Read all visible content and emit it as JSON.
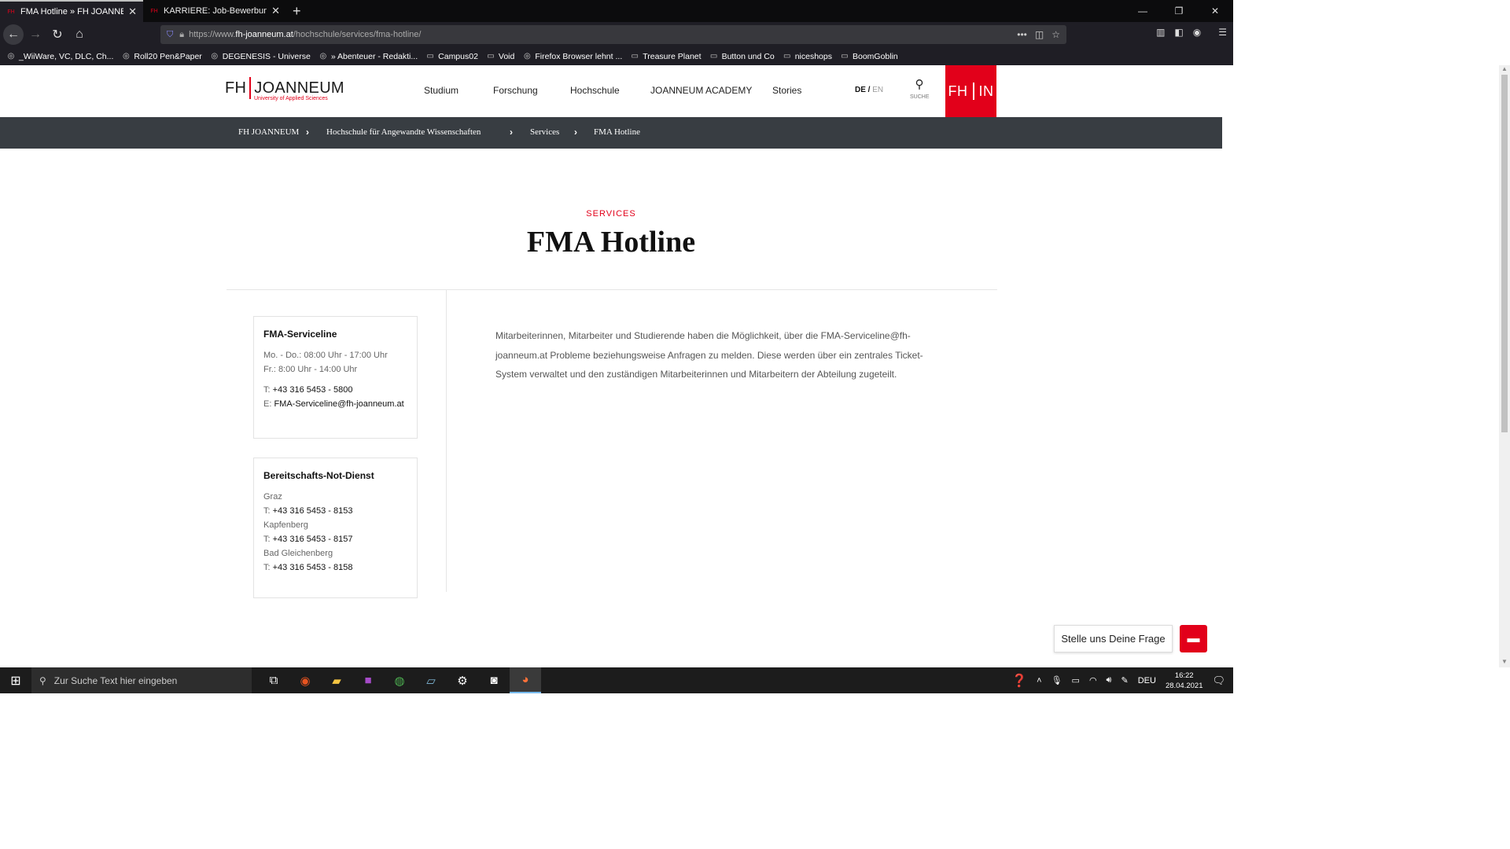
{
  "browser": {
    "tabs": [
      {
        "label": "FMA Hotline » FH JOANNEUM",
        "active": true
      },
      {
        "label": "KARRIERE: Job-Bewerbung – JO",
        "active": false
      }
    ],
    "url_prefix": "https://www.",
    "url_host": "fh-joanneum.at",
    "url_path": "/hochschule/services/fma-hotline/",
    "bookmarks": [
      {
        "label": "_WiiWare, VC, DLC, Ch...",
        "icon": "globe-icon"
      },
      {
        "label": "Roll20 Pen&Paper",
        "icon": "globe-icon"
      },
      {
        "label": "DEGENESIS - Universe",
        "icon": "globe-icon"
      },
      {
        "label": "» Abenteuer - Redakti...",
        "icon": "globe-icon"
      },
      {
        "label": "Campus02",
        "icon": "folder-icon"
      },
      {
        "label": "Void",
        "icon": "folder-icon"
      },
      {
        "label": "Firefox Browser lehnt ...",
        "icon": "globe-icon"
      },
      {
        "label": "Treasure Planet",
        "icon": "folder-icon"
      },
      {
        "label": "Button und Co",
        "icon": "folder-icon"
      },
      {
        "label": "niceshops",
        "icon": "folder-icon"
      },
      {
        "label": "BoomGoblin",
        "icon": "folder-icon"
      }
    ]
  },
  "site": {
    "logo_left": "FH",
    "logo_right": "JOANNEUM",
    "logo_sub": "University of Applied Sciences",
    "nav": [
      "Studium",
      "Forschung",
      "Hochschule",
      "JOANNEUM ACADEMY",
      "Stories"
    ],
    "lang_de": "DE",
    "lang_sep": " / ",
    "lang_en": "EN",
    "search_label": "SUCHE",
    "fhin_left": "FH",
    "fhin_right": "IN",
    "breadcrumbs": [
      "FH JOANNEUM",
      "Hochschule für Angewandte Wissenschaften",
      "Services",
      "FMA Hotline"
    ],
    "kicker": "SERVICES",
    "title": "FMA Hotline",
    "card1": {
      "title": "FMA-Serviceline",
      "hours1": "Mo. - Do.: 08:00 Uhr - 17:00 Uhr",
      "hours2": "Fr.: 8:00 Uhr - 14:00 Uhr",
      "tel_prefix": "T: ",
      "tel": "+43 316 5453 - 5800",
      "mail_prefix": "E: ",
      "mail": "FMA-Serviceline@fh-joanneum.at"
    },
    "card2": {
      "title": "Bereitschafts-Not-Dienst",
      "locations": [
        {
          "city": "Graz",
          "tel": "+43 316 5453 - 8153"
        },
        {
          "city": "Kapfenberg",
          "tel": "+43 316 5453 - 8157"
        },
        {
          "city": "Bad Gleichenberg",
          "tel": "+43 316 5453 - 8158"
        }
      ],
      "tel_prefix": "T: "
    },
    "body": "Mitarbeiterinnen, Mitarbeiter und Studierende haben die Möglichkeit, über die FMA-Serviceline@fh-joanneum.at Probleme beziehungsweise Anfragen zu melden. Diese werden über ein zentrales Ticket-System verwaltet und den zuständigen Mitarbeiterinnen und Mitarbeitern der Abteilung zugeteilt.",
    "chat_label": "Stelle uns Deine Frage"
  },
  "taskbar": {
    "search_placeholder": "Zur Suche Text hier eingeben",
    "lang": "DEU",
    "time": "16:22",
    "date": "28.04.2021"
  }
}
